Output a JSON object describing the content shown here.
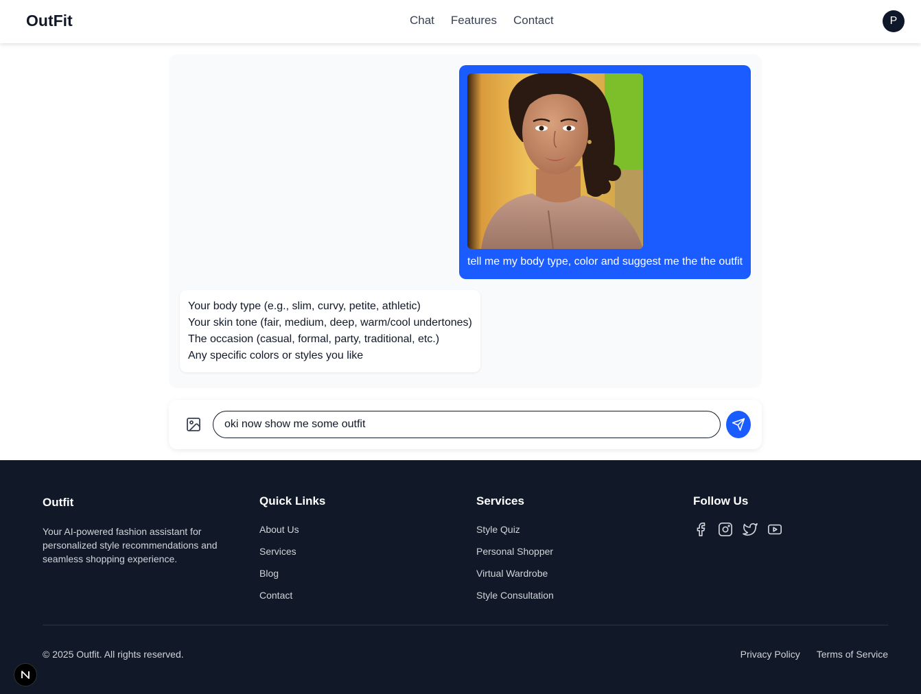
{
  "header": {
    "logo": "OutFit",
    "nav": [
      "Chat",
      "Features",
      "Contact"
    ],
    "avatar_initial": "P"
  },
  "chat": {
    "user_message": {
      "image": "uploaded-photo",
      "text": "tell me my body type, color and suggest me the the outfit"
    },
    "bot_message": {
      "lines": [
        "Your body type (e.g., slim, curvy, petite, athletic)",
        "Your skin tone (fair, medium, deep, warm/cool undertones)",
        "The occasion (casual, formal, party, traditional, etc.)",
        "Any specific colors or styles you like"
      ]
    }
  },
  "composer": {
    "value": "oki now show me some outfit",
    "image_button_icon": "image-icon",
    "send_icon": "send-icon"
  },
  "footer": {
    "brand": {
      "title": "Outfit",
      "description": "Your AI-powered fashion assistant for personalized style recommendations and seamless shopping experience."
    },
    "quick_links": {
      "title": "Quick Links",
      "items": [
        "About Us",
        "Services",
        "Blog",
        "Contact"
      ]
    },
    "services": {
      "title": "Services",
      "items": [
        "Style Quiz",
        "Personal Shopper",
        "Virtual Wardrobe",
        "Style Consultation"
      ]
    },
    "follow": {
      "title": "Follow Us",
      "icons": [
        "facebook-icon",
        "instagram-icon",
        "twitter-icon",
        "youtube-icon"
      ]
    },
    "copyright": "© 2025 Outfit. All rights reserved.",
    "legal": [
      "Privacy Policy",
      "Terms of Service"
    ]
  },
  "dev_badge": "N",
  "colors": {
    "accent": "#1a5cff",
    "footer_bg": "#111827",
    "panel_bg": "#f9fafb"
  }
}
